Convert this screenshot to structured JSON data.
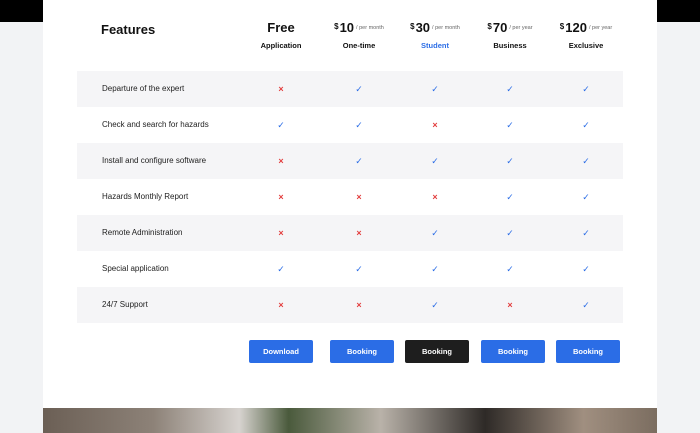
{
  "colors": {
    "accent": "#2b6de6",
    "check": "#2b6de6",
    "cross": "#e33d3d",
    "dark_button": "#1e1e1e"
  },
  "features_title": "Features",
  "plans": [
    {
      "price": "Free",
      "currency": "",
      "amount": "",
      "period": "",
      "name": "Application",
      "button": "Download"
    },
    {
      "price": "",
      "currency": "$",
      "amount": "10",
      "period": "/ per month",
      "name": "One-time",
      "button": "Booking"
    },
    {
      "price": "",
      "currency": "$",
      "amount": "30",
      "period": "/ per month",
      "name": "Student",
      "button": "Booking"
    },
    {
      "price": "",
      "currency": "$",
      "amount": "70",
      "period": "/ per year",
      "name": "Business",
      "button": "Booking"
    },
    {
      "price": "",
      "currency": "$",
      "amount": "120",
      "period": "/ per year",
      "name": "Exclusive",
      "button": "Booking"
    }
  ],
  "rows": [
    {
      "label": "Departure of the expert",
      "values": [
        "no",
        "yes",
        "yes",
        "yes",
        "yes"
      ]
    },
    {
      "label": "Check and search for hazards",
      "values": [
        "yes",
        "yes",
        "no",
        "yes",
        "yes"
      ]
    },
    {
      "label": "Install and configure software",
      "values": [
        "no",
        "yes",
        "yes",
        "yes",
        "yes"
      ]
    },
    {
      "label": "Hazards Monthly Report",
      "values": [
        "no",
        "no",
        "no",
        "yes",
        "yes"
      ]
    },
    {
      "label": "Remote Administration",
      "values": [
        "no",
        "no",
        "yes",
        "yes",
        "yes"
      ]
    },
    {
      "label": "Special application",
      "values": [
        "yes",
        "yes",
        "yes",
        "yes",
        "yes"
      ]
    },
    {
      "label": "24/7 Support",
      "values": [
        "no",
        "no",
        "yes",
        "no",
        "yes"
      ]
    }
  ]
}
